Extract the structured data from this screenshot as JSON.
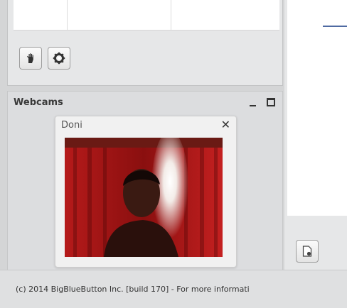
{
  "webcams": {
    "title": "Webcams",
    "camera": {
      "name": "Doni"
    },
    "icons": {
      "minimize": "minimize-icon",
      "maximize": "maximize-icon",
      "close": "close-icon"
    }
  },
  "toolbar": {
    "raise_hand_icon": "raise-hand-icon",
    "settings_icon": "gear-icon"
  },
  "presentation": {
    "upload_icon": "upload-document-icon"
  },
  "footer": {
    "text": "(c) 2014 BigBlueButton Inc. [build 170] - For more informati"
  },
  "colors": {
    "background": "#d4d5d6",
    "panel": "#e6e7e8",
    "accent_line": "#4f6aa2",
    "curtain": "#a81818"
  }
}
